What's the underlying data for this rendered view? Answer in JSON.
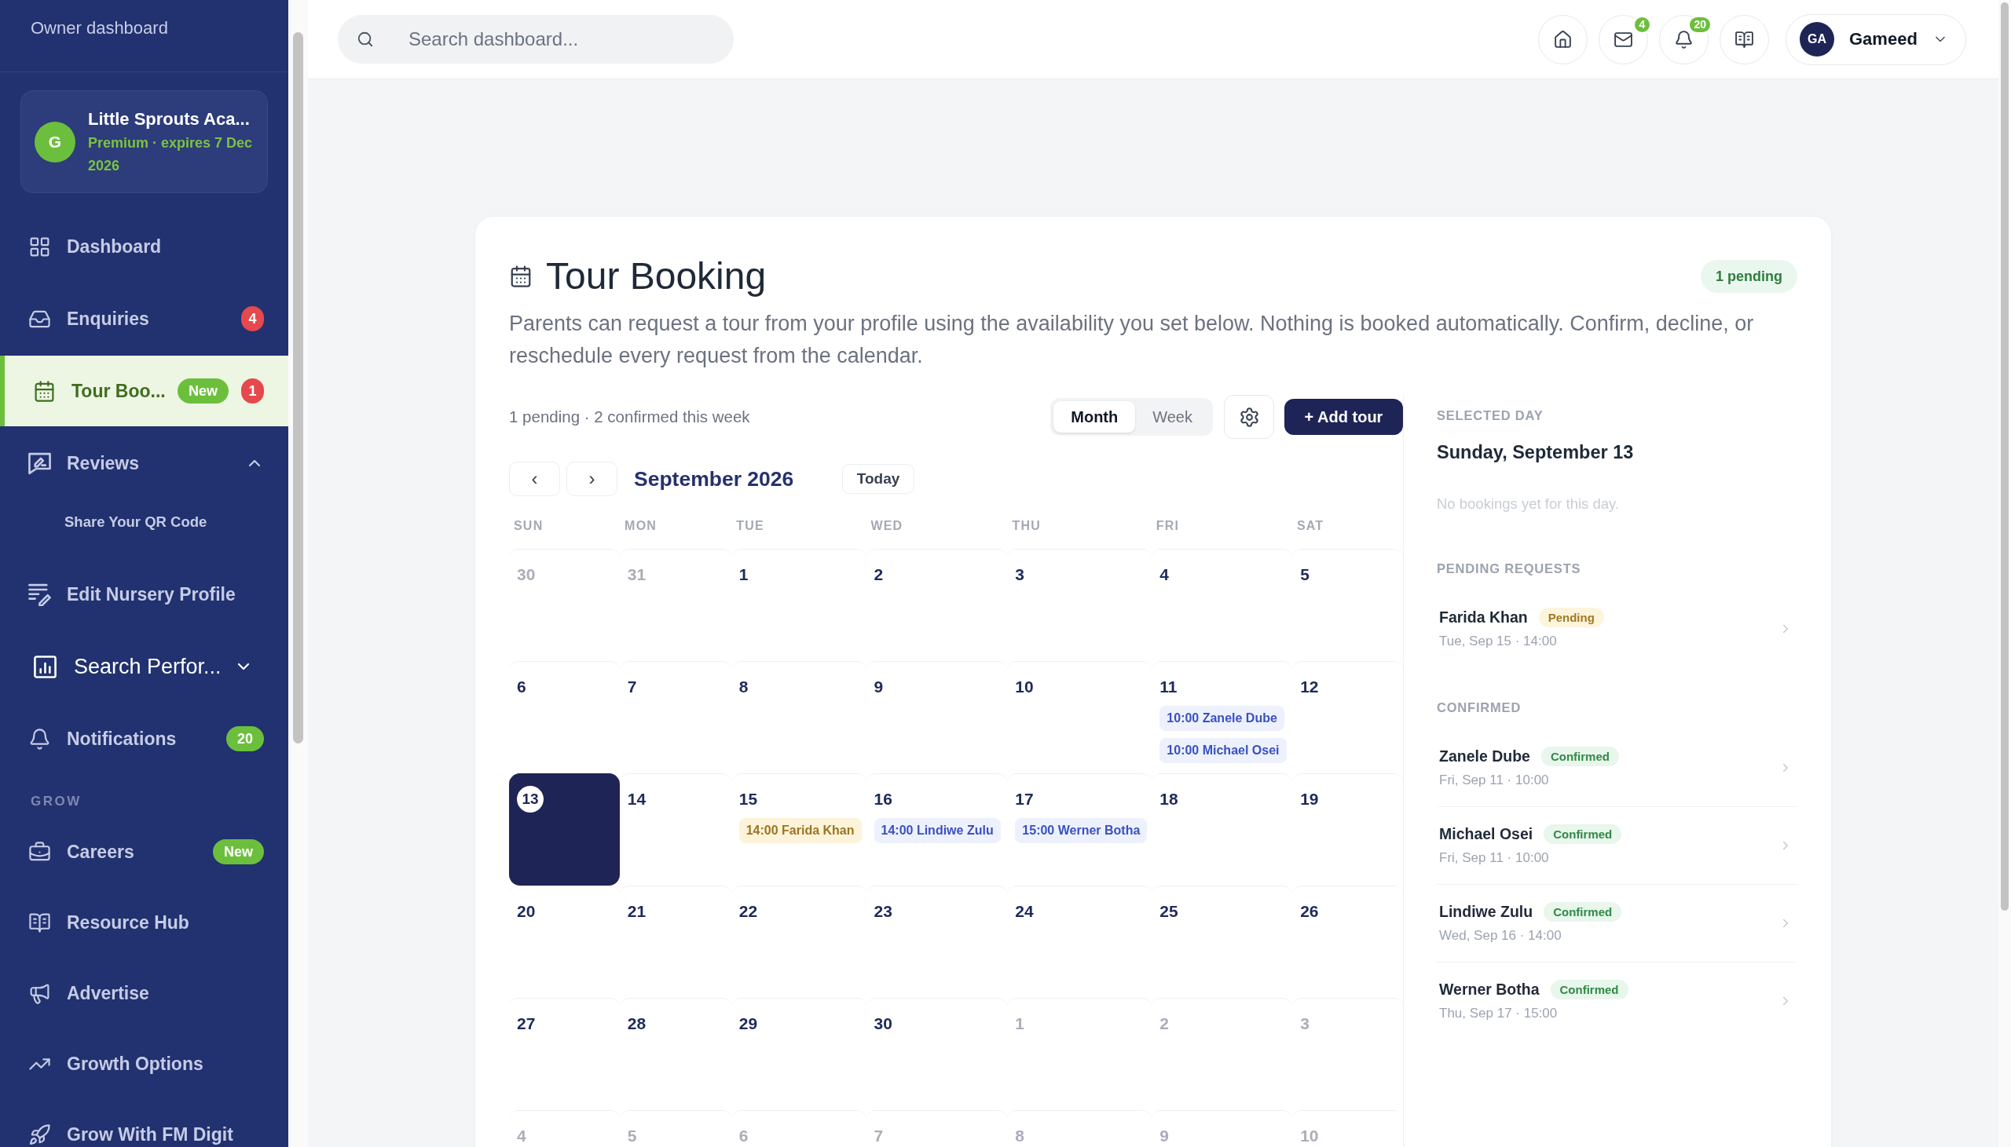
{
  "sidebar": {
    "subtitle": "Owner dashboard",
    "account": {
      "initial": "G",
      "name": "Little Sprouts Aca...",
      "plan": "Premium · expires 7 Dec 2026"
    },
    "sections": [
      {
        "items": [
          {
            "kind": "link",
            "label": "Dashboard",
            "selected": false,
            "hovered": false
          },
          {
            "kind": "link",
            "label": "Enquiries",
            "selected": false,
            "hovered": false,
            "badges": [
              {
                "text": "4",
                "color": "#e5484d"
              }
            ]
          },
          {
            "kind": "link",
            "label": "Tour Boo...",
            "selected": true,
            "hovered": false,
            "badges": [
              {
                "text": "New",
                "color": "#6cbf3c"
              },
              {
                "text": "1",
                "color": "#e5484d"
              }
            ]
          },
          {
            "kind": "group",
            "label": "Reviews",
            "selected": false,
            "hovered": false,
            "expanded": true,
            "children": [
              {
                "label": "Share Your QR Code",
                "selected": false
              }
            ]
          },
          {
            "kind": "link",
            "label": "Edit Nursery Profile",
            "selected": false,
            "hovered": false
          },
          {
            "kind": "group",
            "label": "Search Perfor...",
            "selected": false,
            "hovered": true,
            "expanded": false
          },
          {
            "kind": "link",
            "label": "Notifications",
            "selected": false,
            "hovered": false,
            "badges": [
              {
                "text": "20",
                "color": "#6cbf3c"
              }
            ]
          }
        ]
      },
      {
        "heading": "GROW",
        "items": [
          {
            "kind": "link",
            "label": "Careers",
            "selected": false,
            "hovered": false,
            "badges": [
              {
                "text": "New",
                "color": "#6cbf3c"
              }
            ]
          },
          {
            "kind": "link",
            "label": "Resource Hub",
            "selected": false,
            "hovered": false
          },
          {
            "kind": "link",
            "label": "Advertise",
            "selected": false,
            "hovered": false
          },
          {
            "kind": "link",
            "label": "Growth Options",
            "selected": false,
            "hovered": false
          },
          {
            "kind": "link",
            "label": "Grow With FM Digit",
            "selected": false,
            "hovered": false
          }
        ]
      }
    ]
  },
  "topbar": {
    "search": {
      "placeholder": "Search dashboard..."
    },
    "message_count": "4",
    "notification_count": "20",
    "user": {
      "initials": "GA",
      "name": "Gameed"
    }
  },
  "page": {
    "title": "Tour Booking",
    "status": "1 pending",
    "description": "Parents can request a tour from your profile using the availability you set below. Nothing is booked automatically. Confirm, decline, or reschedule every request from the calendar.",
    "summary": "1 pending · 2 confirmed this week",
    "view_tabs": [
      {
        "label": "Month",
        "selected": true
      },
      {
        "label": "Week",
        "selected": false
      }
    ],
    "add_button": "+ Add tour",
    "calendar": {
      "prev": "‹",
      "next": "›",
      "month": "September 2026",
      "today": "Today",
      "weekdays": [
        "SUN",
        "MON",
        "TUE",
        "WED",
        "THU",
        "FRI",
        "SAT"
      ],
      "weeks": [
        [
          {
            "day": "30",
            "outside": true,
            "selected": false
          },
          {
            "day": "31",
            "outside": true,
            "selected": false
          },
          {
            "day": "1",
            "outside": false,
            "selected": false
          },
          {
            "day": "2",
            "outside": false,
            "selected": false
          },
          {
            "day": "3",
            "outside": false,
            "selected": false
          },
          {
            "day": "4",
            "outside": false,
            "selected": false
          },
          {
            "day": "5",
            "outside": false,
            "selected": false
          }
        ],
        [
          {
            "day": "6",
            "outside": false,
            "selected": false
          },
          {
            "day": "7",
            "outside": false,
            "selected": false
          },
          {
            "day": "8",
            "outside": false,
            "selected": false
          },
          {
            "day": "9",
            "outside": false,
            "selected": false
          },
          {
            "day": "10",
            "outside": false,
            "selected": false
          },
          {
            "day": "11",
            "outside": false,
            "selected": false,
            "events": [
              {
                "label": "10:00 Zanele Dube",
                "kind": "confirmed"
              },
              {
                "label": "10:00 Michael Osei",
                "kind": "confirmed"
              }
            ]
          },
          {
            "day": "12",
            "outside": false,
            "selected": false
          }
        ],
        [
          {
            "day": "13",
            "outside": false,
            "selected": true
          },
          {
            "day": "14",
            "outside": false,
            "selected": false
          },
          {
            "day": "15",
            "outside": false,
            "selected": false,
            "events": [
              {
                "label": "14:00 Farida Khan",
                "kind": "pending"
              }
            ]
          },
          {
            "day": "16",
            "outside": false,
            "selected": false,
            "events": [
              {
                "label": "14:00 Lindiwe Zulu",
                "kind": "confirmed"
              }
            ]
          },
          {
            "day": "17",
            "outside": false,
            "selected": false,
            "events": [
              {
                "label": "15:00 Werner Botha",
                "kind": "confirmed"
              }
            ]
          },
          {
            "day": "18",
            "outside": false,
            "selected": false
          },
          {
            "day": "19",
            "outside": false,
            "selected": false
          }
        ],
        [
          {
            "day": "20",
            "outside": false,
            "selected": false
          },
          {
            "day": "21",
            "outside": false,
            "selected": false
          },
          {
            "day": "22",
            "outside": false,
            "selected": false
          },
          {
            "day": "23",
            "outside": false,
            "selected": false
          },
          {
            "day": "24",
            "outside": false,
            "selected": false
          },
          {
            "day": "25",
            "outside": false,
            "selected": false
          },
          {
            "day": "26",
            "outside": false,
            "selected": false
          }
        ],
        [
          {
            "day": "27",
            "outside": false,
            "selected": false
          },
          {
            "day": "28",
            "outside": false,
            "selected": false
          },
          {
            "day": "29",
            "outside": false,
            "selected": false
          },
          {
            "day": "30",
            "outside": false,
            "selected": false
          },
          {
            "day": "1",
            "outside": true,
            "selected": false
          },
          {
            "day": "2",
            "outside": true,
            "selected": false
          },
          {
            "day": "3",
            "outside": true,
            "selected": false
          }
        ],
        [
          {
            "day": "4",
            "outside": true,
            "selected": false
          },
          {
            "day": "5",
            "outside": true,
            "selected": false
          },
          {
            "day": "6",
            "outside": true,
            "selected": false
          },
          {
            "day": "7",
            "outside": true,
            "selected": false
          },
          {
            "day": "8",
            "outside": true,
            "selected": false
          },
          {
            "day": "9",
            "outside": true,
            "selected": false
          },
          {
            "day": "10",
            "outside": true,
            "selected": false
          }
        ]
      ]
    },
    "details": {
      "heading": "SELECTED DAY",
      "date": "Sunday, September 13",
      "empty_note": "No bookings yet for this day.",
      "sections": [
        {
          "heading": "PENDING REQUESTS",
          "bookings": [
            {
              "name": "Farida Khan",
              "status": "Pending",
              "kind": "pending",
              "when": "Tue, Sep 15 · 14:00"
            }
          ]
        },
        {
          "heading": "CONFIRMED",
          "bookings": [
            {
              "name": "Zanele Dube",
              "status": "Confirmed",
              "kind": "confirmed",
              "when": "Fri, Sep 11 · 10:00"
            },
            {
              "name": "Michael Osei",
              "status": "Confirmed",
              "kind": "confirmed",
              "when": "Fri, Sep 11 · 10:00"
            },
            {
              "name": "Lindiwe Zulu",
              "status": "Confirmed",
              "kind": "confirmed",
              "when": "Wed, Sep 16 · 14:00"
            },
            {
              "name": "Werner Botha",
              "status": "Confirmed",
              "kind": "confirmed",
              "when": "Thu, Sep 17 · 15:00"
            }
          ]
        }
      ]
    }
  }
}
